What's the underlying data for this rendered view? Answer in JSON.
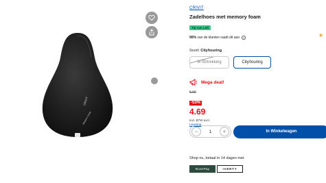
{
  "product": {
    "brand": "CRIVIT",
    "title": "Zadelhoes met memory foam",
    "badge": "Tip van Lidl",
    "recommend_pct": "90%",
    "recommend_text": "van de klanten raadt dit aan",
    "image_alt": "Black padded memory foam bicycle saddle cover with CRIVIT branding"
  },
  "variant": {
    "label": "Soort:",
    "selected": "City/touring",
    "options": [
      {
        "label": "MTB/trekking",
        "available": false
      },
      {
        "label": "City/touring",
        "available": true,
        "selected": true
      }
    ]
  },
  "deal": {
    "label": "Mega deal!",
    "old_price": "5.99",
    "discount": "-53%",
    "price": "4.69",
    "vat_note": "Incl. BTW excl.",
    "delivery_link": "Levering"
  },
  "cart": {
    "quantity": "1",
    "minus": "−",
    "plus": "+",
    "button_label": "In Winkelwagen"
  },
  "payment": {
    "text": "Shop nu, betaal in 14 dagen met",
    "providers": [
      "RiverPay",
      "IVERTY"
    ]
  },
  "colors": {
    "accent_blue": "#0050aa",
    "deal_red": "#e60a14",
    "badge_green": "#3bc48a"
  },
  "icons": {
    "favorite": "heart-icon",
    "share": "share-icon",
    "deal": "megaphone-icon",
    "rating": "star-icon",
    "info": "info-icon"
  }
}
